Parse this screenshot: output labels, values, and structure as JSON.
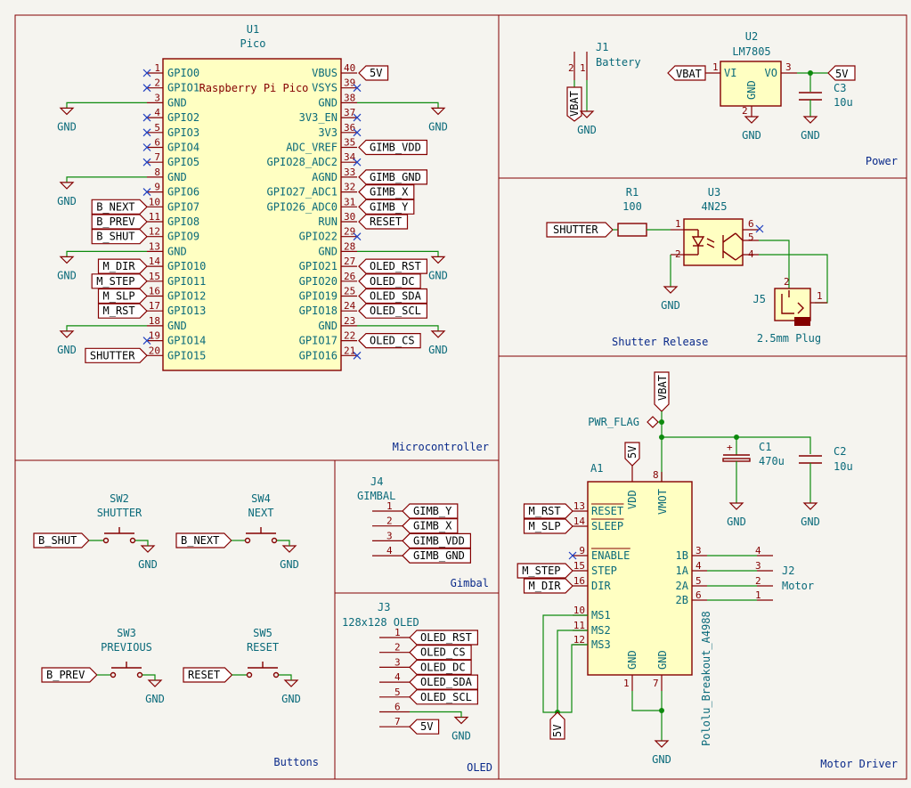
{
  "sections": {
    "microcontroller": "Microcontroller",
    "power": "Power",
    "shutter": "Shutter Release",
    "motor": "Motor Driver",
    "buttons": "Buttons",
    "gimbal": "Gimbal",
    "oled": "OLED"
  },
  "u1": {
    "ref": "U1",
    "value": "Pico",
    "title": "Raspberry Pi Pico",
    "left_pins": [
      {
        "num": "1",
        "name": "GPIO0",
        "net": "nc"
      },
      {
        "num": "2",
        "name": "GPIO1",
        "net": "nc"
      },
      {
        "num": "3",
        "name": "GND",
        "net": "GND"
      },
      {
        "num": "4",
        "name": "GPIO2",
        "net": "nc"
      },
      {
        "num": "5",
        "name": "GPIO3",
        "net": "nc"
      },
      {
        "num": "6",
        "name": "GPIO4",
        "net": "nc"
      },
      {
        "num": "7",
        "name": "GPIO5",
        "net": "nc"
      },
      {
        "num": "8",
        "name": "GND",
        "net": "GND"
      },
      {
        "num": "9",
        "name": "GPIO6",
        "net": "nc"
      },
      {
        "num": "10",
        "name": "GPIO7",
        "net": "B_NEXT"
      },
      {
        "num": "11",
        "name": "GPIO8",
        "net": "B_PREV"
      },
      {
        "num": "12",
        "name": "GPIO9",
        "net": "B_SHUT"
      },
      {
        "num": "13",
        "name": "GND",
        "net": "GND"
      },
      {
        "num": "14",
        "name": "GPIO10",
        "net": "M_DIR"
      },
      {
        "num": "15",
        "name": "GPIO11",
        "net": "M_STEP"
      },
      {
        "num": "16",
        "name": "GPIO12",
        "net": "M_SLP"
      },
      {
        "num": "17",
        "name": "GPIO13",
        "net": "M_RST"
      },
      {
        "num": "18",
        "name": "GND",
        "net": "GND"
      },
      {
        "num": "19",
        "name": "GPIO14",
        "net": "nc"
      },
      {
        "num": "20",
        "name": "GPIO15",
        "net": "SHUTTER"
      }
    ],
    "right_pins": [
      {
        "num": "40",
        "name": "VBUS",
        "net": "5V"
      },
      {
        "num": "39",
        "name": "VSYS",
        "net": "nc"
      },
      {
        "num": "38",
        "name": "GND",
        "net": "GND"
      },
      {
        "num": "37",
        "name": "3V3_EN",
        "net": "nc"
      },
      {
        "num": "36",
        "name": "3V3",
        "net": "nc"
      },
      {
        "num": "35",
        "name": "ADC_VREF",
        "net": "GIMB_VDD"
      },
      {
        "num": "34",
        "name": "GPIO28_ADC2",
        "net": "nc"
      },
      {
        "num": "33",
        "name": "AGND",
        "net": "GIMB_GND"
      },
      {
        "num": "32",
        "name": "GPIO27_ADC1",
        "net": "GIMB_X"
      },
      {
        "num": "31",
        "name": "GPIO26_ADC0",
        "net": "GIMB_Y"
      },
      {
        "num": "30",
        "name": "RUN",
        "net": "RESET"
      },
      {
        "num": "29",
        "name": "GPIO22",
        "net": "nc"
      },
      {
        "num": "28",
        "name": "GND",
        "net": "GND"
      },
      {
        "num": "27",
        "name": "GPIO21",
        "net": "OLED_RST"
      },
      {
        "num": "26",
        "name": "GPIO20",
        "net": "OLED_DC"
      },
      {
        "num": "25",
        "name": "GPIO19",
        "net": "OLED_SDA"
      },
      {
        "num": "24",
        "name": "GPIO18",
        "net": "OLED_SCL"
      },
      {
        "num": "23",
        "name": "GND",
        "net": "GND"
      },
      {
        "num": "22",
        "name": "GPIO17",
        "net": "OLED_CS"
      },
      {
        "num": "21",
        "name": "GPIO16",
        "net": "nc"
      }
    ]
  },
  "gnd": "GND",
  "power": {
    "j1_ref": "J1",
    "j1_value": "Battery",
    "j1_pin1": "1",
    "j1_pin2": "2",
    "vbat": "VBAT",
    "u2_ref": "U2",
    "u2_value": "LM7805",
    "u2_vi": "VI",
    "u2_vo": "VO",
    "u2_gnd": "GND",
    "u2_p1": "1",
    "u2_p2": "2",
    "u2_p3": "3",
    "c3_ref": "C3",
    "c3_value": "10u",
    "out": "5V"
  },
  "shutter": {
    "net": "SHUTTER",
    "r1_ref": "R1",
    "r1_value": "100",
    "u3_ref": "U3",
    "u3_value": "4N25",
    "p1": "1",
    "p2": "2",
    "p4": "4",
    "p5": "5",
    "p6": "6",
    "j5_ref": "J5",
    "j5_value": "2.5mm Plug",
    "j5_p1": "1",
    "j5_p2": "2"
  },
  "motor": {
    "vbat": "VBAT",
    "pwr_flag": "PWR_FLAG",
    "c1_ref": "C1",
    "c1_value": "470u",
    "c2_ref": "C2",
    "c2_value": "10u",
    "a1_ref": "A1",
    "a1_value": "Pololu_Breakout_A4988",
    "vdd_label": "5V",
    "vdd": "VDD",
    "vmot": "VMOT",
    "p7": "7",
    "p8": "8",
    "p1": "1",
    "left_pins": [
      {
        "num": "13",
        "name": "RESET",
        "net": "M_RST",
        "bar": true
      },
      {
        "num": "14",
        "name": "SLEEP",
        "net": "M_SLP",
        "bar": true
      },
      {
        "num": "9",
        "name": "ENABLE",
        "net": "nc",
        "bar": true
      },
      {
        "num": "15",
        "name": "STEP",
        "net": "M_STEP",
        "bar": false
      },
      {
        "num": "16",
        "name": "DIR",
        "net": "M_DIR",
        "bar": false
      },
      {
        "num": "10",
        "name": "MS1",
        "net": "5V",
        "bar": false
      },
      {
        "num": "11",
        "name": "MS2",
        "net": "5V",
        "bar": false
      },
      {
        "num": "12",
        "name": "MS3",
        "net": "5V",
        "bar": false
      }
    ],
    "right_pins": [
      {
        "num": "3",
        "name": "1B",
        "jnum": "4"
      },
      {
        "num": "4",
        "name": "1A",
        "jnum": "3"
      },
      {
        "num": "5",
        "name": "2A",
        "jnum": "2"
      },
      {
        "num": "6",
        "name": "2B",
        "jnum": "1"
      }
    ],
    "bottom_gnd_l": "GND",
    "bottom_gnd_r": "GND",
    "j2_ref": "J2",
    "j2_value": "Motor",
    "ms_net": "5V"
  },
  "buttons": [
    {
      "ref": "SW2",
      "value": "SHUTTER",
      "net": "B_SHUT"
    },
    {
      "ref": "SW4",
      "value": "NEXT",
      "net": "B_NEXT"
    },
    {
      "ref": "SW3",
      "value": "PREVIOUS",
      "net": "B_PREV"
    },
    {
      "ref": "SW5",
      "value": "RESET",
      "net": "RESET"
    }
  ],
  "gimbal": {
    "ref": "J4",
    "value": "GIMBAL",
    "pins": [
      {
        "num": "1",
        "net": "GIMB_Y"
      },
      {
        "num": "2",
        "net": "GIMB_X"
      },
      {
        "num": "3",
        "net": "GIMB_VDD"
      },
      {
        "num": "4",
        "net": "GIMB_GND"
      }
    ]
  },
  "oled": {
    "ref": "J3",
    "value": "128x128 OLED",
    "pins": [
      {
        "num": "1",
        "net": "OLED_RST"
      },
      {
        "num": "2",
        "net": "OLED_CS"
      },
      {
        "num": "3",
        "net": "OLED_DC"
      },
      {
        "num": "4",
        "net": "OLED_SDA"
      },
      {
        "num": "5",
        "net": "OLED_SCL"
      },
      {
        "num": "6",
        "net": "GND"
      },
      {
        "num": "7",
        "net": "5V"
      }
    ]
  }
}
